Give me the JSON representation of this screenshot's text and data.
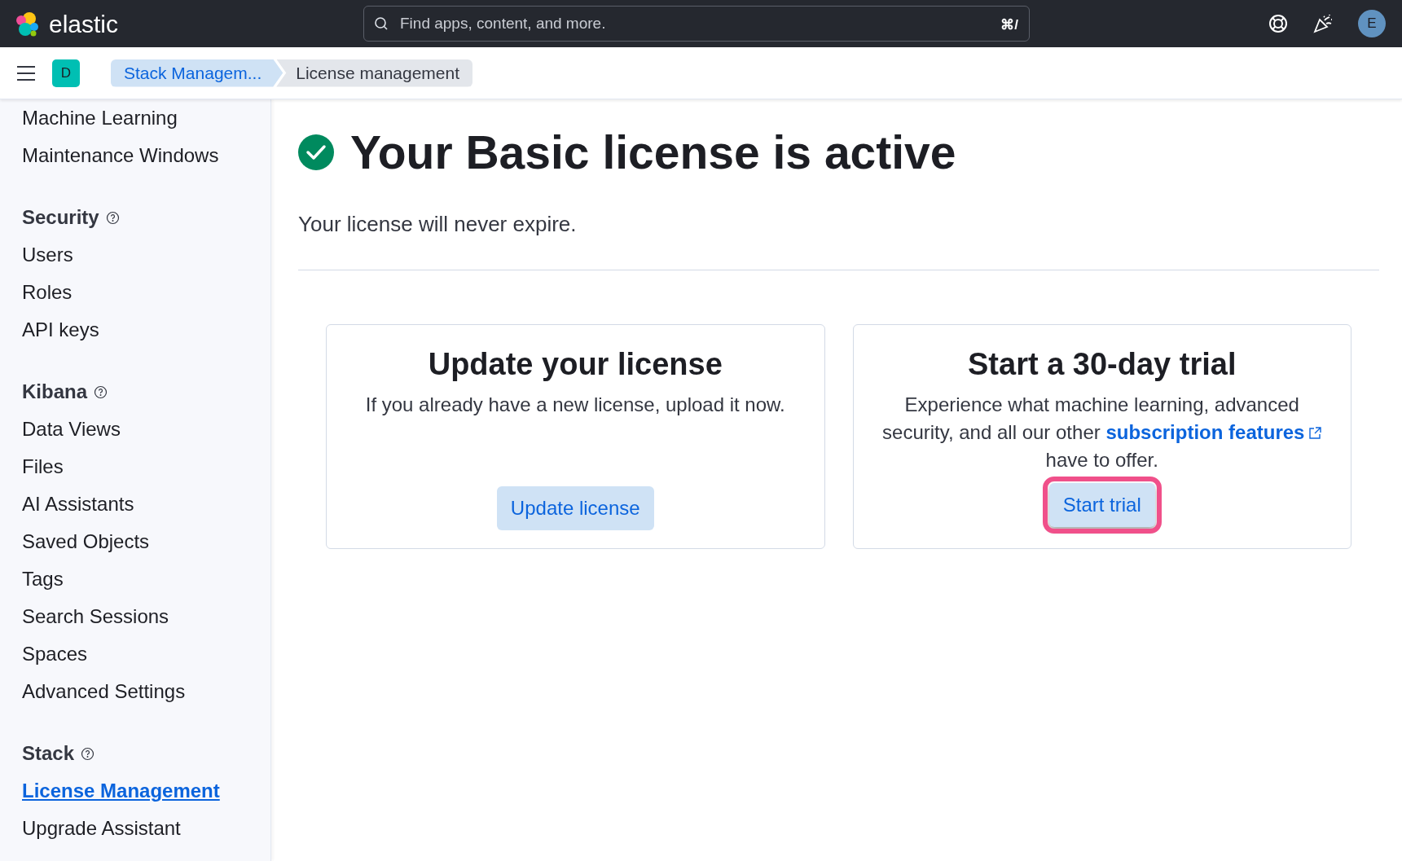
{
  "header": {
    "logo_text": "elastic",
    "search": {
      "placeholder": "Find apps, content, and more.",
      "shortcut": "⌘/"
    },
    "avatar": "E"
  },
  "breadcrumbs": {
    "space": "D",
    "items": [
      {
        "label": "Stack Managem...",
        "kind": "link"
      },
      {
        "label": "License management",
        "kind": "current"
      }
    ]
  },
  "sidebar": {
    "sections": [
      {
        "items": [
          {
            "label": "Machine Learning",
            "selected": false
          },
          {
            "label": "Maintenance Windows",
            "selected": false
          }
        ]
      },
      {
        "title": "Security",
        "help": true,
        "items": [
          {
            "label": "Users",
            "selected": false
          },
          {
            "label": "Roles",
            "selected": false
          },
          {
            "label": "API keys",
            "selected": false
          }
        ]
      },
      {
        "title": "Kibana",
        "help": true,
        "items": [
          {
            "label": "Data Views",
            "selected": false
          },
          {
            "label": "Files",
            "selected": false
          },
          {
            "label": "AI Assistants",
            "selected": false
          },
          {
            "label": "Saved Objects",
            "selected": false
          },
          {
            "label": "Tags",
            "selected": false
          },
          {
            "label": "Search Sessions",
            "selected": false
          },
          {
            "label": "Spaces",
            "selected": false
          },
          {
            "label": "Advanced Settings",
            "selected": false
          }
        ]
      },
      {
        "title": "Stack",
        "help": true,
        "items": [
          {
            "label": "License Management",
            "selected": true
          },
          {
            "label": "Upgrade Assistant",
            "selected": false
          }
        ]
      }
    ]
  },
  "main": {
    "title": "Your Basic license is active",
    "subtitle": "Your license will never expire.",
    "cards": [
      {
        "title": "Update your license",
        "text": [
          "If you already have a new license, upload it now."
        ],
        "button": {
          "label": "Update license",
          "highlighted": false
        }
      },
      {
        "title": "Start a 30-day trial",
        "text": [
          "Experience what machine learning, advanced security, and all our other"
        ],
        "link": "subscription features",
        "text_after": "have to offer.",
        "button": {
          "label": "Start trial",
          "highlighted": true
        }
      }
    ]
  }
}
